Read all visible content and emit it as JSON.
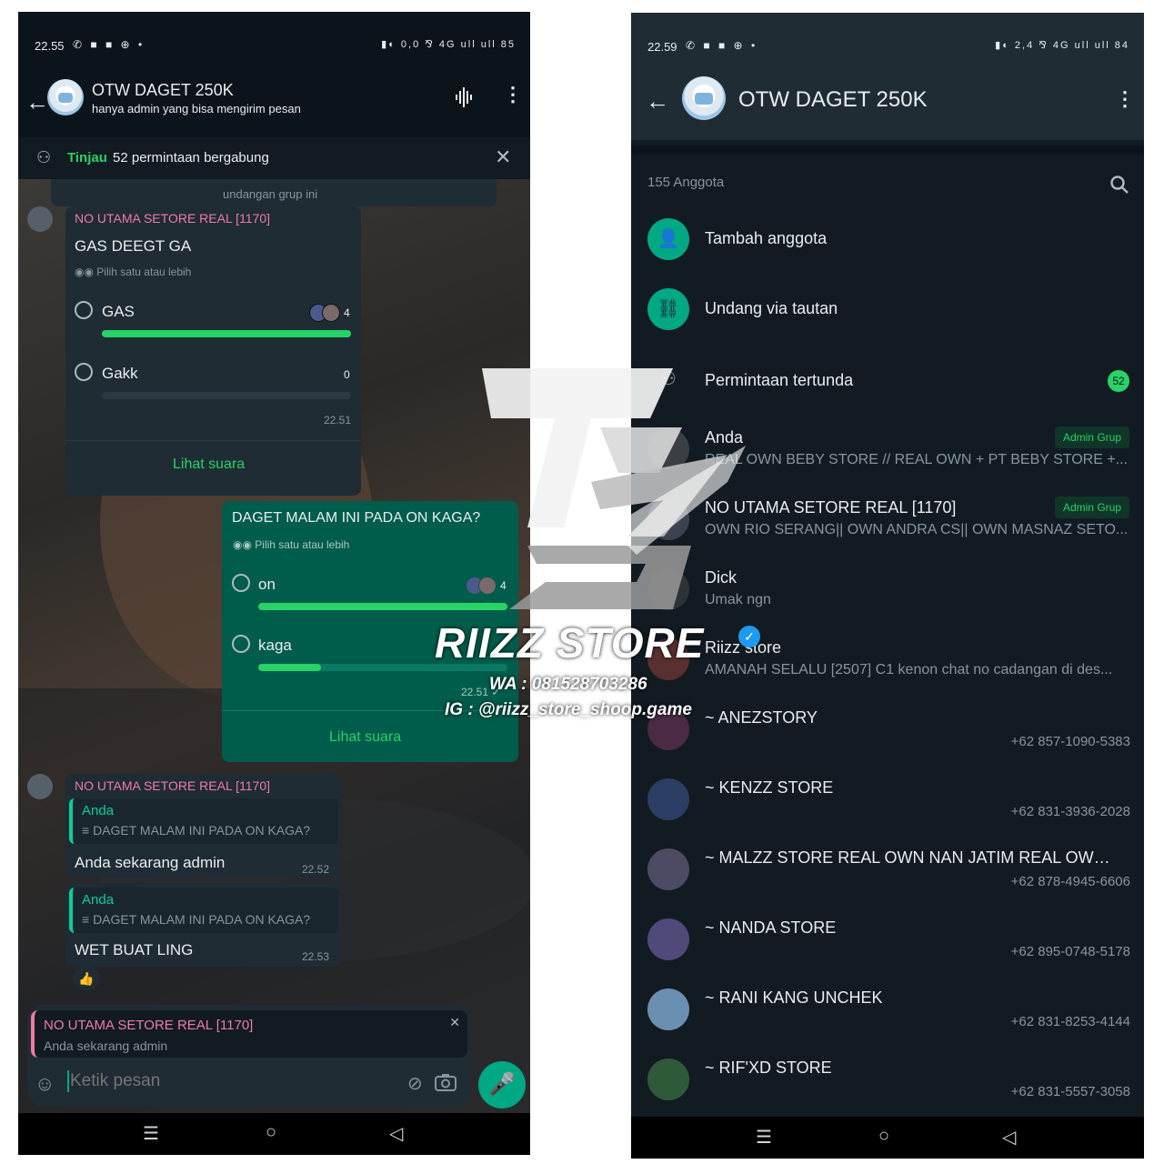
{
  "left": {
    "status": {
      "time": "22.55",
      "icons_left": "✆ ■ ■ ⊕ •",
      "icons_right": "▮◐ 0,0 ⅋ 4G ull ull 85"
    },
    "header": {
      "title": "OTW DAGET 250K",
      "subtitle": "hanya admin yang bisa mengirim pesan"
    },
    "notice": {
      "link": "Tinjau",
      "text": "52 permintaan bergabung"
    },
    "top_fragment": "undangan grup ini",
    "poll1": {
      "sender": "NO UTAMA SETORE REAL [1170]",
      "question": "GAS DEEGT GA",
      "hint": "Pilih satu atau lebih",
      "options": [
        {
          "label": "GAS",
          "count": "4",
          "fraction": 1.0
        },
        {
          "label": "Gakk",
          "count": "0",
          "fraction": 0.0
        }
      ],
      "time": "22.51",
      "view_votes": "Lihat suara"
    },
    "poll2": {
      "question": "DAGET MALAM INI PADA ON KAGA?",
      "hint": "Pilih satu atau lebih",
      "options": [
        {
          "label": "on",
          "count": "4",
          "fraction": 1.0
        },
        {
          "label": "kaga",
          "count": "",
          "fraction": 0.25
        }
      ],
      "time": "22.51 ✓",
      "view_votes": "Lihat suara"
    },
    "msg1": {
      "sender": "NO UTAMA SETORE REAL [1170]",
      "quote_name": "Anda",
      "quote_text": "DAGET MALAM INI PADA ON KAGA?",
      "text": "Anda sekarang admin",
      "time": "22.52"
    },
    "msg2": {
      "quote_name": "Anda",
      "quote_text": "DAGET MALAM INI PADA ON KAGA?",
      "text": "WET BUAT LING",
      "time": "22.53",
      "reaction": "👍"
    },
    "reply": {
      "name": "NO UTAMA SETORE REAL [1170]",
      "text": "Anda sekarang admin"
    },
    "composer": {
      "placeholder": "Ketik pesan"
    }
  },
  "right": {
    "status": {
      "time": "22.59",
      "icons_left": "✆ ■ ■ ⊕ •",
      "icons_right": "▮◐ 2,4 ⅋ 4G ull ull 84"
    },
    "header": {
      "title": "OTW DAGET 250K"
    },
    "member_count": "155 Anggota",
    "actions": [
      {
        "label": "Tambah anggota",
        "icon": "add-person-icon"
      },
      {
        "label": "Undang via tautan",
        "icon": "link-icon"
      },
      {
        "label": "Permintaan tertunda",
        "icon": "pending-person-icon",
        "badge": "52"
      }
    ],
    "members": [
      {
        "name": "Anda",
        "sub": "REAL OWN BEBY STORE // REAL OWN + PT BEBY STORE +...",
        "badge": "Admin Grup",
        "phone": ""
      },
      {
        "name": "NO UTAMA SETORE REAL [1170]",
        "sub": "OWN RIO SERANG|| OWN ANDRA CS|| OWN MASNAZ SETO...",
        "badge": "Admin Grup",
        "phone": ""
      },
      {
        "name": "Dick",
        "sub": "Umak ngn",
        "badge": "",
        "phone": ""
      },
      {
        "name": "Riizz store",
        "sub": "AMANAH SELALU [2507] C1 kenon chat no cadangan di des...",
        "badge": "",
        "phone": ""
      },
      {
        "name": "~ ANEZSTORY",
        "sub": "",
        "badge": "",
        "phone": "+62 857-1090-5383"
      },
      {
        "name": "~ KENZZ STORE",
        "sub": "",
        "badge": "",
        "phone": "+62 831-3936-2028"
      },
      {
        "name": "~ MALZZ STORE REAL OWN NAN JATIM REAL OWN...",
        "sub": "",
        "badge": "",
        "phone": "+62 878-4945-6606"
      },
      {
        "name": "~ NANDA STORE",
        "sub": "",
        "badge": "",
        "phone": "+62 895-0748-5178"
      },
      {
        "name": "~ RANI KANG UNCHEK",
        "sub": "",
        "badge": "",
        "phone": "+62 831-8253-4144"
      },
      {
        "name": "~ RIF'XD STORE",
        "sub": "",
        "badge": "",
        "phone": "+62 831-5557-3058"
      }
    ]
  },
  "watermark": {
    "logo": "RS",
    "name": "RIIZZ STORE",
    "wa": "WA : 081528703286",
    "ig": "IG : @riizz_store_shoop.game"
  },
  "nav": {
    "recent": "☰",
    "home": "○",
    "back": "◁"
  },
  "colors": {
    "accent": "#25d366",
    "bubble_out": "#005c4b",
    "bubble_in": "#1f2c34",
    "sender": "#f27aa5"
  }
}
